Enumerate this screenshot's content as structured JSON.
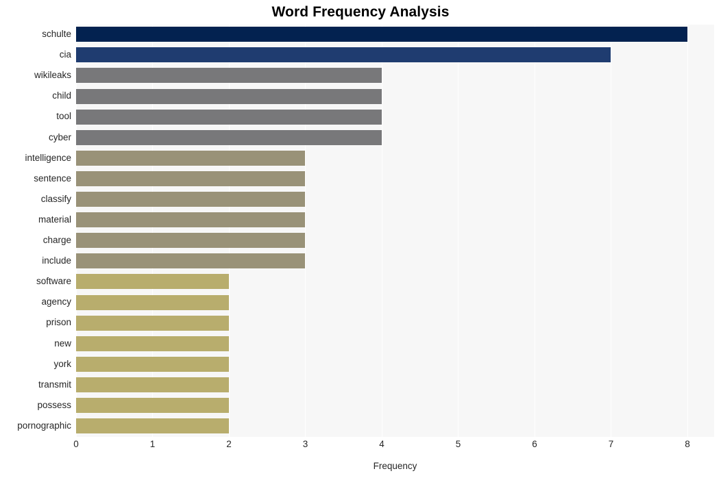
{
  "chart_data": {
    "type": "bar",
    "orientation": "horizontal",
    "title": "Word Frequency Analysis",
    "xlabel": "Frequency",
    "ylabel": "",
    "xlim": [
      0,
      8.35
    ],
    "ylim": [
      0,
      19
    ],
    "grid": "vertical-white-on-light-gray",
    "legend": "none",
    "xticks": [
      "0",
      "1",
      "2",
      "3",
      "4",
      "5",
      "6",
      "7",
      "8"
    ],
    "xtick_values": [
      0,
      1,
      2,
      3,
      4,
      5,
      6,
      7,
      8
    ],
    "categories": [
      "schulte",
      "cia",
      "wikileaks",
      "child",
      "tool",
      "cyber",
      "intelligence",
      "sentence",
      "classify",
      "material",
      "charge",
      "include",
      "software",
      "agency",
      "prison",
      "new",
      "york",
      "transmit",
      "possess",
      "pornographic"
    ],
    "values": [
      8,
      7,
      4,
      4,
      4,
      4,
      3,
      3,
      3,
      3,
      3,
      3,
      2,
      2,
      2,
      2,
      2,
      2,
      2,
      2
    ],
    "bar_colors": [
      "#032250",
      "#1f3c70",
      "#78787a",
      "#78787a",
      "#78787a",
      "#78787a",
      "#999278",
      "#999278",
      "#999278",
      "#999278",
      "#999278",
      "#999278",
      "#b8ad6d",
      "#b8ad6d",
      "#b8ad6d",
      "#b8ad6d",
      "#b8ad6d",
      "#b8ad6d",
      "#b8ad6d",
      "#b8ad6d"
    ]
  },
  "colors": {
    "figure_background": "#ffffff",
    "plot_background": "#f7f7f7",
    "gridline": "#ffffff",
    "title_text": "#000000",
    "tick_text": "#262626"
  }
}
